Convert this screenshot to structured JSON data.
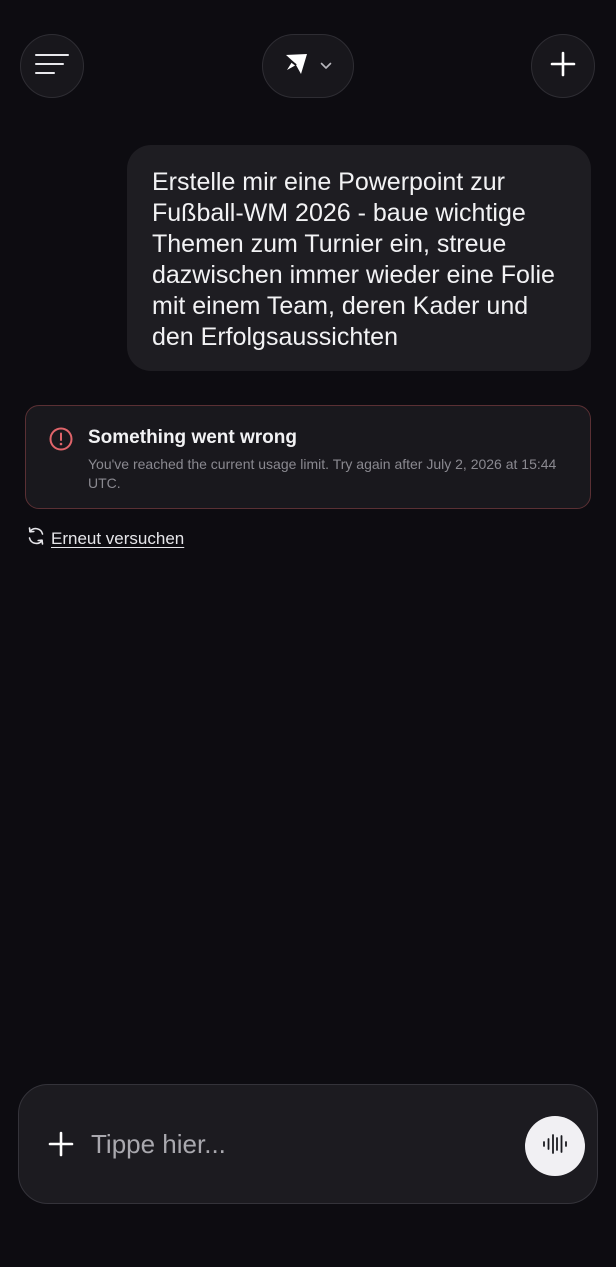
{
  "header": {
    "menu_icon": "menu-lines-icon",
    "model_icon": "kite-logo-icon",
    "model_chevron_icon": "chevron-down-icon",
    "new_chat_icon": "plus-icon"
  },
  "chat": {
    "user_message": "Erstelle mir eine Powerpoint zur Fußball-WM 2026 - baue wichtige Themen zum Turnier ein, streue dazwischen immer wieder eine Folie mit einem Team, deren Kader und den Erfolgsaussichten",
    "user_message_lines": [
      "Erstelle mir eine Powerpoint zur",
      "Fußball-WM 2026 - baue wichtige",
      "Themen zum Turnier ein, streue",
      "dazwischen immer wieder eine Folie",
      "mit einem Team, deren Kader und",
      "den Erfolgsaussichten"
    ],
    "error": {
      "icon": "alert-circle-icon",
      "title": "Something went wrong",
      "message": "You've reached the current usage limit. Try again after July 2, 2026 at 15:44 UTC."
    },
    "retry": {
      "icon": "refresh-icon",
      "label": "Erneut versuchen"
    }
  },
  "composer": {
    "attach_icon": "plus-icon",
    "placeholder": "Tippe hier...",
    "value": "",
    "voice_icon": "waveform-icon"
  },
  "colors": {
    "background": "#0d0c11",
    "bubble": "#1e1d22",
    "error_accent": "#e0646a",
    "error_border": "#5a3034"
  }
}
